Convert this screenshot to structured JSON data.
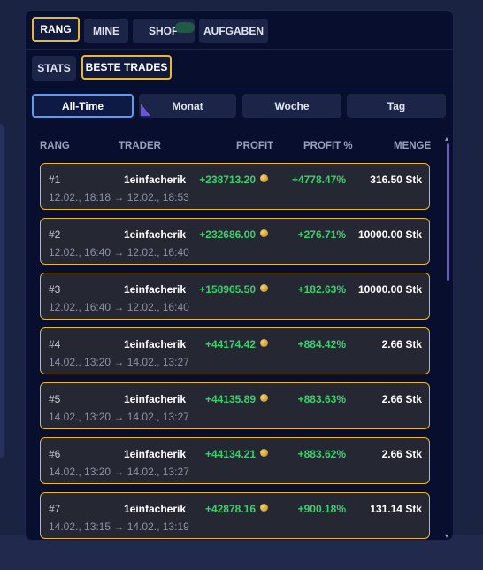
{
  "main_tabs": [
    {
      "label": "RANG",
      "active": true
    },
    {
      "label": "MINE",
      "active": false
    },
    {
      "label": "SHOP",
      "active": false
    },
    {
      "label": "AUFGABEN",
      "active": false
    }
  ],
  "sub_tabs": [
    {
      "label": "STATS",
      "active": false
    },
    {
      "label": "BESTE TRADES",
      "active": true
    }
  ],
  "ranges": [
    {
      "label": "All-Time",
      "active": true
    },
    {
      "label": "Monat",
      "active": false
    },
    {
      "label": "Woche",
      "active": false
    },
    {
      "label": "Tag",
      "active": false
    }
  ],
  "columns": {
    "rank": "RANG",
    "trader": "TRADER",
    "profit": "PROFIT",
    "profit_pct": "PROFIT %",
    "amount": "MENGE"
  },
  "trades": [
    {
      "rank": "#1",
      "trader": "1einfacherik",
      "profit": "+238713.20",
      "pct": "+4778.47%",
      "qty": "316.50 Stk",
      "time": "12.02., 18:18 → 12.02., 18:53"
    },
    {
      "rank": "#2",
      "trader": "1einfacherik",
      "profit": "+232686.00",
      "pct": "+276.71%",
      "qty": "10000.00 Stk",
      "time": "12.02., 16:40 → 12.02., 16:40"
    },
    {
      "rank": "#3",
      "trader": "1einfacherik",
      "profit": "+158965.50",
      "pct": "+182.63%",
      "qty": "10000.00 Stk",
      "time": "12.02., 16:40 → 12.02., 16:40"
    },
    {
      "rank": "#4",
      "trader": "1einfacherik",
      "profit": "+44174.42",
      "pct": "+884.42%",
      "qty": "2.66 Stk",
      "time": "14.02., 13:20 → 14.02., 13:27"
    },
    {
      "rank": "#5",
      "trader": "1einfacherik",
      "profit": "+44135.89",
      "pct": "+883.63%",
      "qty": "2.66 Stk",
      "time": "14.02., 13:20 → 14.02., 13:27"
    },
    {
      "rank": "#6",
      "trader": "1einfacherik",
      "profit": "+44134.21",
      "pct": "+883.62%",
      "qty": "2.66 Stk",
      "time": "14.02., 13:20 → 14.02., 13:27"
    },
    {
      "rank": "#7",
      "trader": "1einfacherik",
      "profit": "+42878.16",
      "pct": "+900.18%",
      "qty": "131.14 Stk",
      "time": "14.02., 13:15 → 14.02., 13:19"
    }
  ],
  "icons": {
    "coin": "coin-icon",
    "scroll_up": "▴",
    "scroll_down": "▾"
  },
  "colors": {
    "accent_gold": "#e8b92f",
    "active_blue": "#5b9bf2",
    "profit_green": "#3ad16c",
    "scroll_purple": "#6b59d3"
  }
}
